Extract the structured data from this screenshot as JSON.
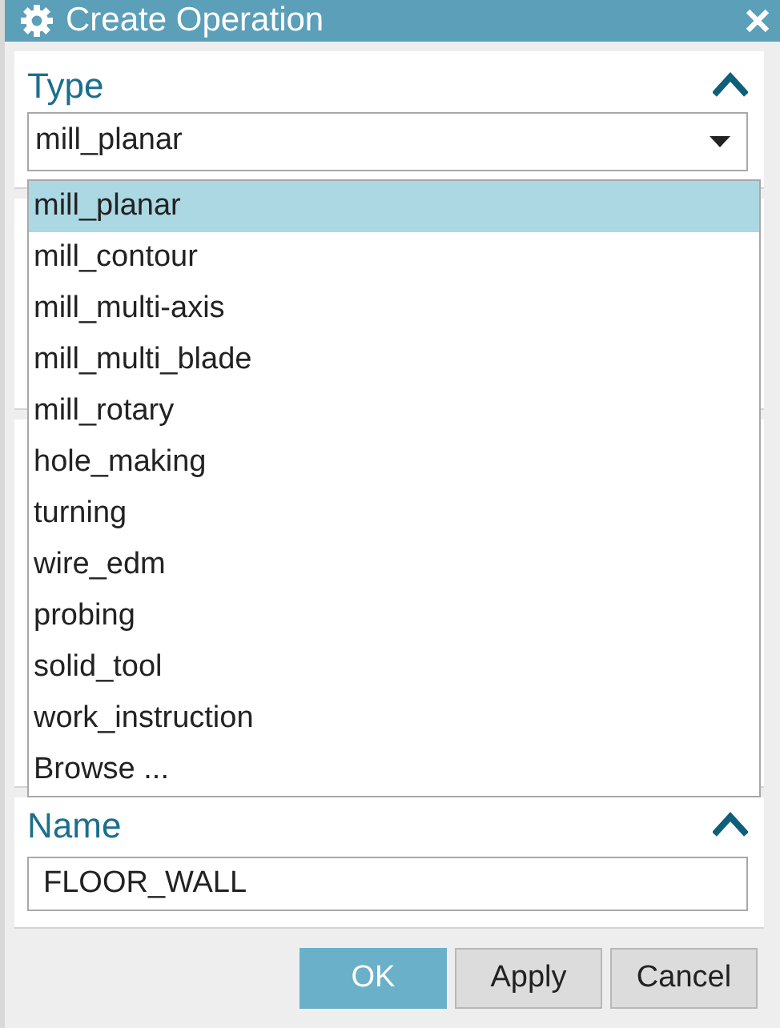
{
  "window": {
    "title": "Create Operation"
  },
  "type_section": {
    "label": "Type",
    "expanded": true,
    "value": "mill_planar",
    "dropdown_open": true,
    "options": [
      {
        "label": "mill_planar",
        "selected": true
      },
      {
        "label": "mill_contour",
        "selected": false
      },
      {
        "label": "mill_multi-axis",
        "selected": false
      },
      {
        "label": "mill_multi_blade",
        "selected": false
      },
      {
        "label": "mill_rotary",
        "selected": false
      },
      {
        "label": "hole_making",
        "selected": false
      },
      {
        "label": "turning",
        "selected": false
      },
      {
        "label": "wire_edm",
        "selected": false
      },
      {
        "label": "probing",
        "selected": false
      },
      {
        "label": "solid_tool",
        "selected": false
      },
      {
        "label": "work_instruction",
        "selected": false
      },
      {
        "label": "Browse ...",
        "selected": false
      }
    ]
  },
  "name_section": {
    "label": "Name",
    "expanded": true,
    "value": "FLOOR_WALL"
  },
  "buttons": [
    {
      "label": "OK",
      "kind": "primary"
    },
    {
      "label": "Apply",
      "kind": "default"
    },
    {
      "label": "Cancel",
      "kind": "default"
    }
  ]
}
